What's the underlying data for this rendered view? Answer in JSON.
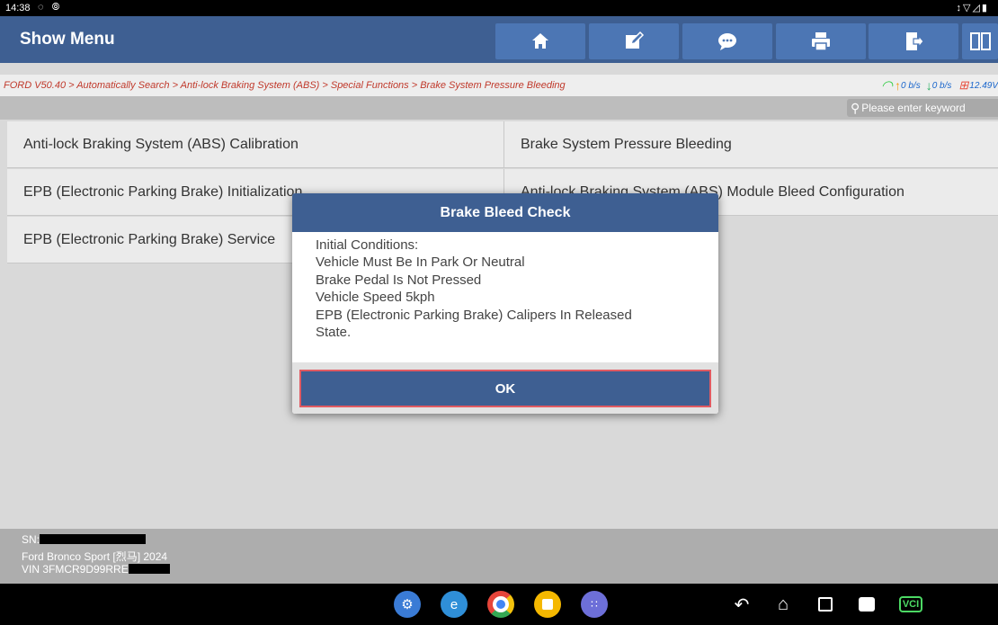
{
  "status_bar": {
    "time": "14:38",
    "left_icons": "◌ ⦾",
    "right_icons": "↕▽◿▮"
  },
  "header": {
    "title": "Show Menu",
    "buttons": [
      {
        "icon": "home-icon"
      },
      {
        "icon": "edit-icon"
      },
      {
        "icon": "chat-icon"
      },
      {
        "icon": "print-icon"
      },
      {
        "icon": "exit-icon"
      },
      {
        "icon": "split-view-icon"
      }
    ]
  },
  "breadcrumb": "FORD V50.40 > Automatically Search > Anti-lock Braking System (ABS) > Special Functions > Brake System Pressure Bleeding",
  "network": {
    "upload": "0 b/s",
    "download": "0 b/s",
    "voltage": "12.49V"
  },
  "search": {
    "placeholder": "Please enter keyword"
  },
  "functions": [
    {
      "label": "Anti-lock Braking System (ABS) Calibration"
    },
    {
      "label": "Brake System Pressure Bleeding"
    },
    {
      "label": "EPB (Electronic Parking Brake) Initialization"
    },
    {
      "label": "Anti-lock Braking System (ABS) Module Bleed Configuration"
    },
    {
      "label": "EPB (Electronic Parking Brake) Service"
    }
  ],
  "vehicle_info": {
    "sn_label": "SN:",
    "model": "Ford Bronco Sport [烈马] 2024",
    "vin_label": "VIN 3FMCR9D99RRE"
  },
  "dialog": {
    "title": "Brake Bleed Check",
    "lines": [
      "Initial Conditions:",
      "Vehicle Must Be In Park Or Neutral",
      "Brake Pedal Is Not Pressed",
      "Vehicle Speed 5kph",
      "EPB (Electronic Parking Brake) Calipers In Released",
      "State."
    ],
    "ok_label": "OK"
  },
  "taskbar": {
    "apps": [
      "settings-app-icon",
      "browser-app-icon",
      "chrome-app-icon",
      "notes-app-icon",
      "app-drawer-icon"
    ],
    "nav": [
      "back-icon",
      "home-nav-icon",
      "recents-icon",
      "gallery-icon",
      "vci-icon"
    ]
  },
  "colors": {
    "header": "#3e5f92",
    "button": "#4c76b4",
    "crumb_text": "#c0392b",
    "ok_border": "#e05a62"
  }
}
